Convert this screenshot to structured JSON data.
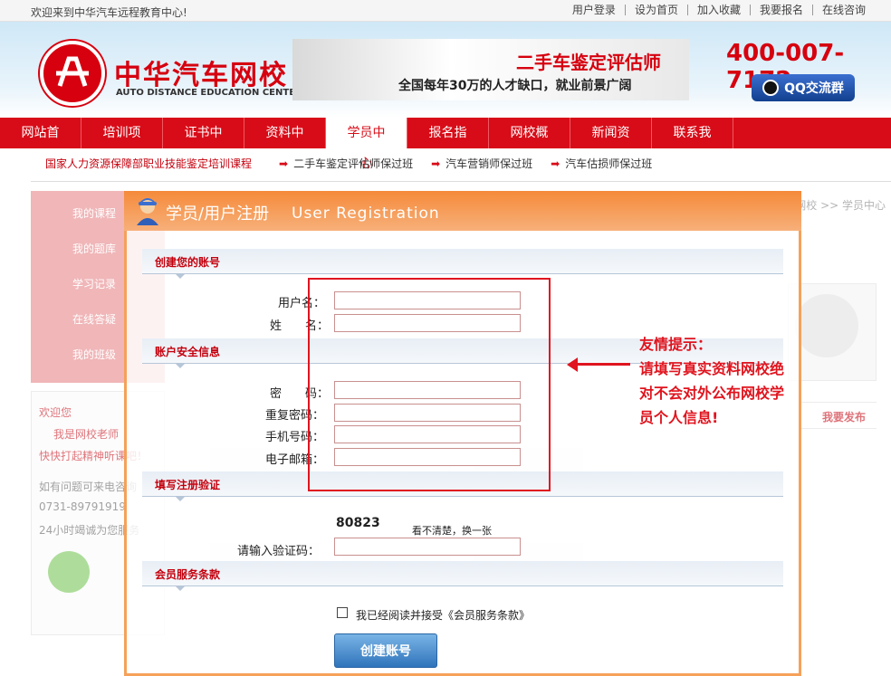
{
  "topbar": {
    "welcome": "欢迎来到中华汽车远程教育中心!",
    "links": [
      "用户登录",
      "设为首页",
      "加入收藏",
      "我要报名",
      "在线咨询"
    ]
  },
  "header": {
    "logo_cn": "中华汽车网校",
    "logo_en": "AUTO DISTANCE EDUCATION CENTER",
    "banner_title": "二手车鉴定评估师",
    "banner_subtitle": "全国每年30万的人才缺口，就业前景广阔",
    "phone": "400-007-7172",
    "qq_button": "QQ交流群"
  },
  "nav": {
    "items": [
      "网站首页",
      "培训项目",
      "证书中心",
      "资料中心",
      "学员中心",
      "报名指南",
      "网校概况",
      "新闻资讯",
      "联系我们"
    ],
    "active_index": 4
  },
  "subnav": {
    "title": "国家人力资源保障部职业技能鉴定培训课程",
    "links": [
      "二手车鉴定评估师保过班",
      "汽车营销师保过班",
      "汽车估损师保过班"
    ],
    "arrow": "➡"
  },
  "background": {
    "left_menu": [
      "我的课程",
      "我的题库",
      "学习记录",
      "在线答疑",
      "我的班级"
    ],
    "left_box": {
      "welcome": "欢迎您",
      "role": "我是网校老师",
      "slogan": "快快打起精神听课吧！",
      "contact_text": "如有问题可来电咨询",
      "phone": "0731-89791919",
      "service": "24小时竭诚为您服务"
    },
    "breadcrumb": "您的位置：中华汽车网校 >> 学员中心",
    "right_publish": "我要发布"
  },
  "modal": {
    "title_cn": "学员/用户注册",
    "title_en": "User Registration",
    "sections": {
      "account": "创建您的账号",
      "security": "账户安全信息",
      "verify": "填写注册验证",
      "terms": "会员服务条款"
    },
    "fields": {
      "username": "用户名：",
      "name": "姓　　名：",
      "password": "密　　码：",
      "password_repeat": "重复密码：",
      "mobile": "手机号码：",
      "email": "电子邮箱："
    },
    "tip": [
      "友情提示：",
      "请填写真实资料网校绝",
      "对不会对外公布网校学",
      "员个人信息!"
    ],
    "captcha_code": "80823",
    "captcha_refresh": "看不清楚，换一张",
    "captcha_label": "请输入验证码：",
    "agree_text": "我已经阅读并接受《会员服务条款》",
    "create_button": "创建账号"
  },
  "colors": {
    "brand_red": "#d80c18",
    "modal_orange": "#f58a3a",
    "tip_red": "#e0141e",
    "button_blue": "#2f74bb"
  }
}
